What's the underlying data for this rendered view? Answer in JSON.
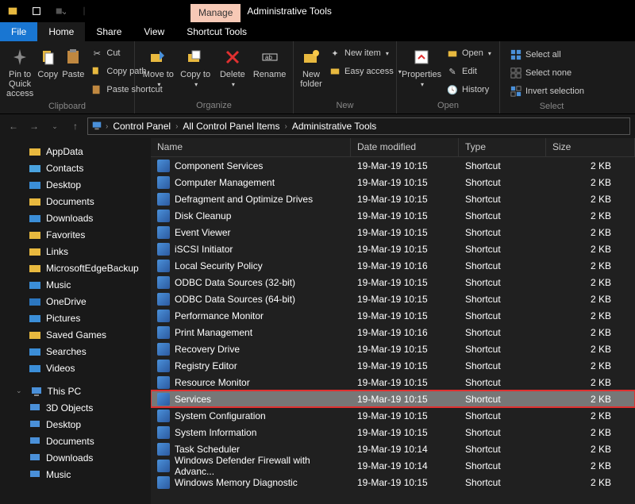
{
  "titlebar": {
    "manage": "Manage",
    "title": "Administrative Tools"
  },
  "tabs": {
    "file": "File",
    "home": "Home",
    "share": "Share",
    "view": "View",
    "shortcut": "Shortcut Tools"
  },
  "ribbon": {
    "pin": "Pin to Quick access",
    "copy": "Copy",
    "paste": "Paste",
    "cut": "Cut",
    "copypath": "Copy path",
    "pastesc": "Paste shortcut",
    "moveto": "Move to",
    "copyto": "Copy to",
    "delete": "Delete",
    "rename": "Rename",
    "newfolder": "New folder",
    "newitem": "New item",
    "easyaccess": "Easy access",
    "properties": "Properties",
    "open": "Open",
    "edit": "Edit",
    "history": "History",
    "selectall": "Select all",
    "selectnone": "Select none",
    "invert": "Invert selection",
    "g_clipboard": "Clipboard",
    "g_organize": "Organize",
    "g_new": "New",
    "g_open": "Open",
    "g_select": "Select"
  },
  "crumbs": [
    "Control Panel",
    "All Control Panel Items",
    "Administrative Tools"
  ],
  "cols": {
    "name": "Name",
    "date": "Date modified",
    "type": "Type",
    "size": "Size"
  },
  "sidebar": [
    {
      "label": "AppData",
      "ico": "#e8b93f"
    },
    {
      "label": "Contacts",
      "ico": "#4aa3df"
    },
    {
      "label": "Desktop",
      "ico": "#3b8ed8"
    },
    {
      "label": "Documents",
      "ico": "#e8b93f"
    },
    {
      "label": "Downloads",
      "ico": "#3b8ed8"
    },
    {
      "label": "Favorites",
      "ico": "#e8b93f"
    },
    {
      "label": "Links",
      "ico": "#e8b93f"
    },
    {
      "label": "MicrosoftEdgeBackup",
      "ico": "#e8b93f"
    },
    {
      "label": "Music",
      "ico": "#3b8ed8"
    },
    {
      "label": "OneDrive",
      "ico": "#2c77c0"
    },
    {
      "label": "Pictures",
      "ico": "#3b8ed8"
    },
    {
      "label": "Saved Games",
      "ico": "#e8b93f"
    },
    {
      "label": "Searches",
      "ico": "#3b8ed8"
    },
    {
      "label": "Videos",
      "ico": "#3b8ed8"
    }
  ],
  "thispc": "This PC",
  "pc_items": [
    {
      "label": "3D Objects"
    },
    {
      "label": "Desktop"
    },
    {
      "label": "Documents"
    },
    {
      "label": "Downloads"
    },
    {
      "label": "Music"
    }
  ],
  "files": [
    {
      "name": "Component Services",
      "date": "19-Mar-19 10:15",
      "type": "Shortcut",
      "size": "2 KB"
    },
    {
      "name": "Computer Management",
      "date": "19-Mar-19 10:15",
      "type": "Shortcut",
      "size": "2 KB"
    },
    {
      "name": "Defragment and Optimize Drives",
      "date": "19-Mar-19 10:15",
      "type": "Shortcut",
      "size": "2 KB"
    },
    {
      "name": "Disk Cleanup",
      "date": "19-Mar-19 10:15",
      "type": "Shortcut",
      "size": "2 KB"
    },
    {
      "name": "Event Viewer",
      "date": "19-Mar-19 10:15",
      "type": "Shortcut",
      "size": "2 KB"
    },
    {
      "name": "iSCSI Initiator",
      "date": "19-Mar-19 10:15",
      "type": "Shortcut",
      "size": "2 KB"
    },
    {
      "name": "Local Security Policy",
      "date": "19-Mar-19 10:16",
      "type": "Shortcut",
      "size": "2 KB"
    },
    {
      "name": "ODBC Data Sources (32-bit)",
      "date": "19-Mar-19 10:15",
      "type": "Shortcut",
      "size": "2 KB"
    },
    {
      "name": "ODBC Data Sources (64-bit)",
      "date": "19-Mar-19 10:15",
      "type": "Shortcut",
      "size": "2 KB"
    },
    {
      "name": "Performance Monitor",
      "date": "19-Mar-19 10:15",
      "type": "Shortcut",
      "size": "2 KB"
    },
    {
      "name": "Print Management",
      "date": "19-Mar-19 10:16",
      "type": "Shortcut",
      "size": "2 KB"
    },
    {
      "name": "Recovery Drive",
      "date": "19-Mar-19 10:15",
      "type": "Shortcut",
      "size": "2 KB"
    },
    {
      "name": "Registry Editor",
      "date": "19-Mar-19 10:15",
      "type": "Shortcut",
      "size": "2 KB"
    },
    {
      "name": "Resource Monitor",
      "date": "19-Mar-19 10:15",
      "type": "Shortcut",
      "size": "2 KB"
    },
    {
      "name": "Services",
      "date": "19-Mar-19 10:15",
      "type": "Shortcut",
      "size": "2 KB",
      "sel": true,
      "hl": true
    },
    {
      "name": "System Configuration",
      "date": "19-Mar-19 10:15",
      "type": "Shortcut",
      "size": "2 KB"
    },
    {
      "name": "System Information",
      "date": "19-Mar-19 10:15",
      "type": "Shortcut",
      "size": "2 KB"
    },
    {
      "name": "Task Scheduler",
      "date": "19-Mar-19 10:14",
      "type": "Shortcut",
      "size": "2 KB"
    },
    {
      "name": "Windows Defender Firewall with Advanc...",
      "date": "19-Mar-19 10:14",
      "type": "Shortcut",
      "size": "2 KB"
    },
    {
      "name": "Windows Memory Diagnostic",
      "date": "19-Mar-19 10:15",
      "type": "Shortcut",
      "size": "2 KB"
    }
  ]
}
